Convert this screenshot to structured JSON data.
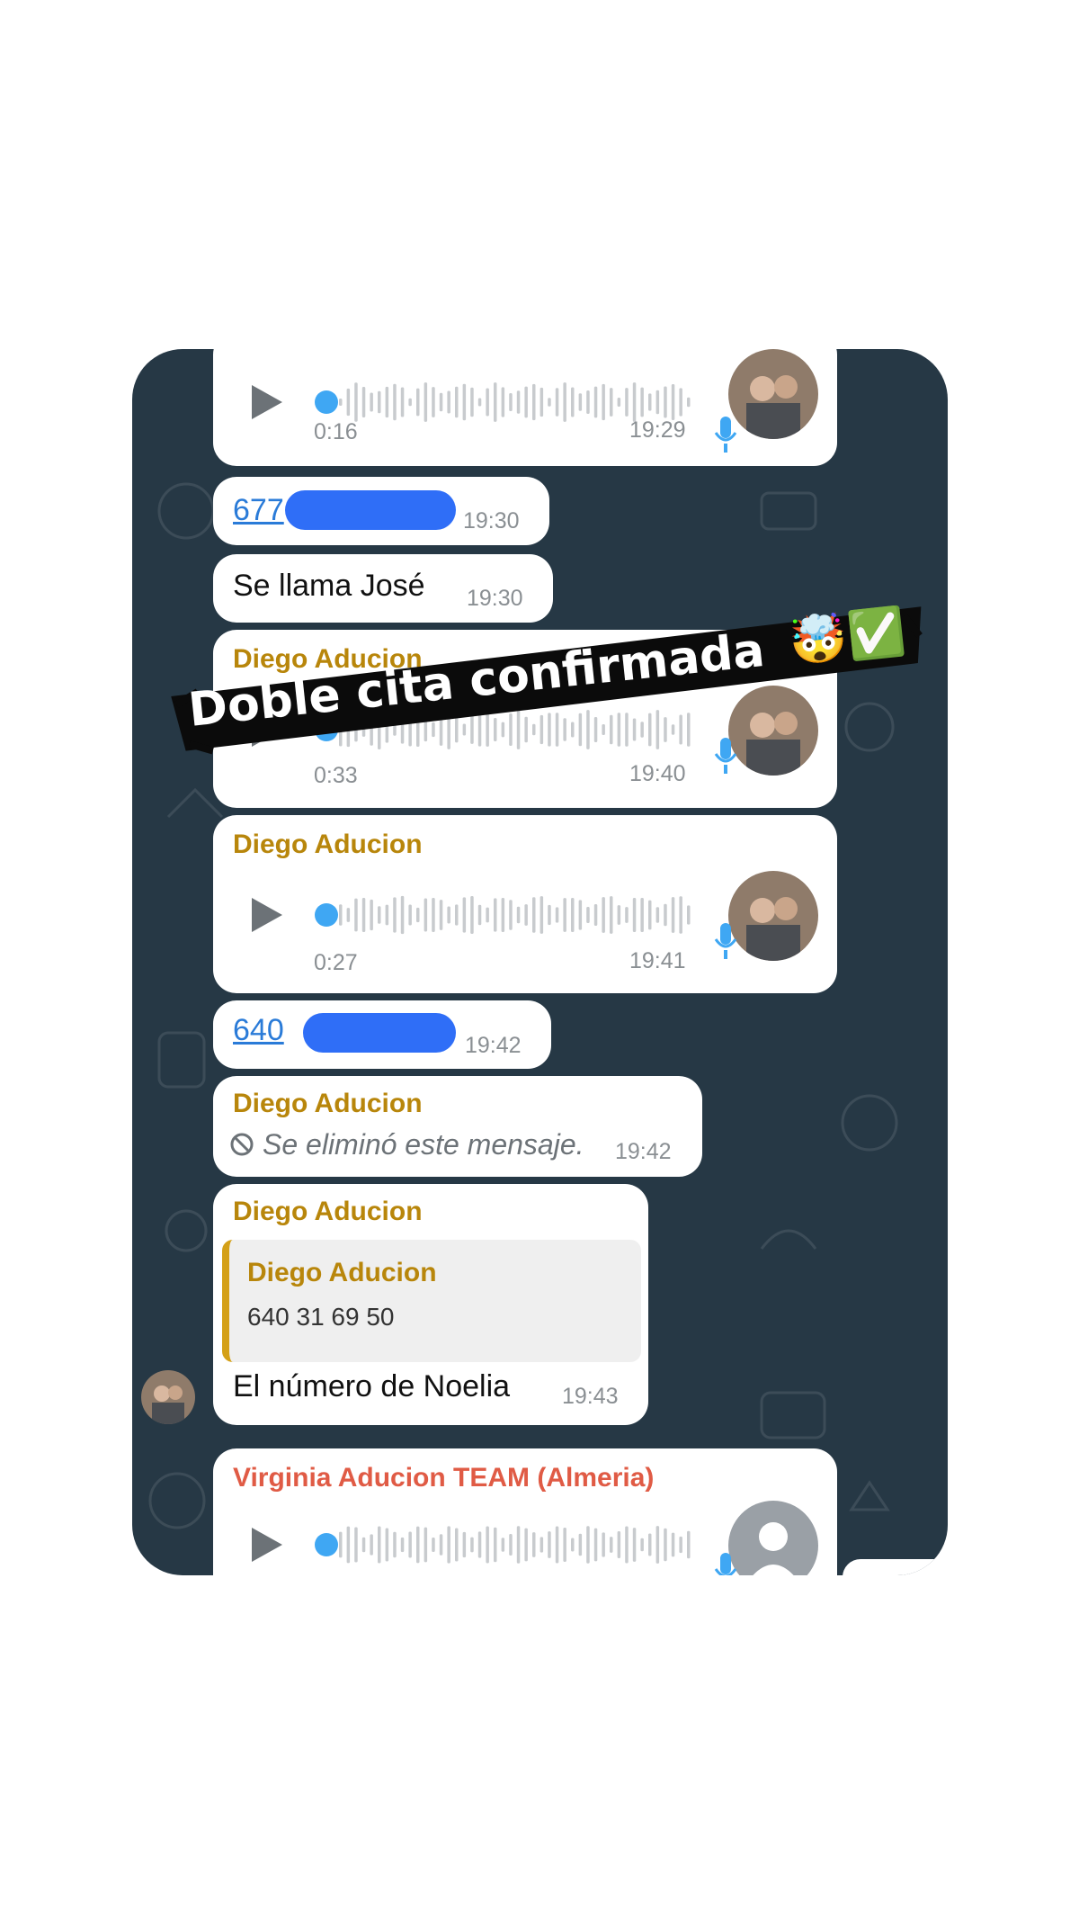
{
  "messages": [
    {
      "type": "voice",
      "duration": "0:16",
      "time": "19:29"
    },
    {
      "type": "phone",
      "number": "677",
      "time": "19:30"
    },
    {
      "type": "text",
      "text": "Se llama José",
      "time": "19:30"
    },
    {
      "type": "voice",
      "sender": "Diego Aducion",
      "duration": "0:33",
      "time": "19:40"
    },
    {
      "type": "voice",
      "sender": "Diego Aducion",
      "duration": "0:27",
      "time": "19:41"
    },
    {
      "type": "phone",
      "number": "640",
      "time": "19:42"
    },
    {
      "type": "deleted",
      "sender": "Diego Aducion",
      "text": "Se eliminó este mensaje.",
      "time": "19:42"
    },
    {
      "type": "reply",
      "sender": "Diego Aducion",
      "quote_sender": "Diego Aducion",
      "quote_text": "640 31 69 50",
      "text": "El número de Noelia",
      "time": "19:43"
    },
    {
      "type": "voice",
      "sender": "Virginia Aducion TEAM (Almeria)"
    }
  ],
  "overlay": {
    "caption": "Doble cita confirmada",
    "emoji": "🤯✅"
  },
  "colors": {
    "chat_bg": "#263845",
    "sender_gold": "#b8860b",
    "sender_red": "#e05b45",
    "accent_blue": "#3fa7f3"
  },
  "icons": [
    "play-icon",
    "microphone-icon",
    "blocked-icon",
    "avatar-photo",
    "default-avatar-icon"
  ]
}
